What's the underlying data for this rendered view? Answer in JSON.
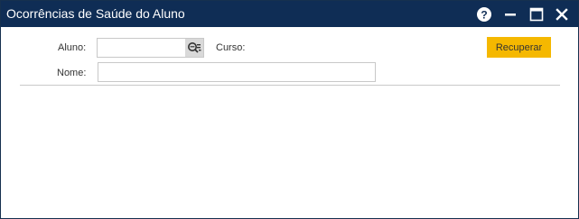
{
  "window": {
    "title": "Ocorrências de Saúde do Aluno",
    "titlebar_color": "#0f2d55"
  },
  "titlebar_buttons": {
    "help": "question-icon",
    "minimize": "minimize-icon",
    "maximize": "maximize-icon",
    "close": "close-icon"
  },
  "form": {
    "aluno_label": "Aluno:",
    "aluno_value": "",
    "aluno_placeholder": "",
    "lookup_icon": "search-list-icon",
    "curso_label": "Curso:",
    "curso_value": "",
    "nome_label": "Nome:",
    "nome_value": "",
    "nome_placeholder": ""
  },
  "actions": {
    "recuperar_label": "Recuperar",
    "accent_color": "#f5b800"
  }
}
